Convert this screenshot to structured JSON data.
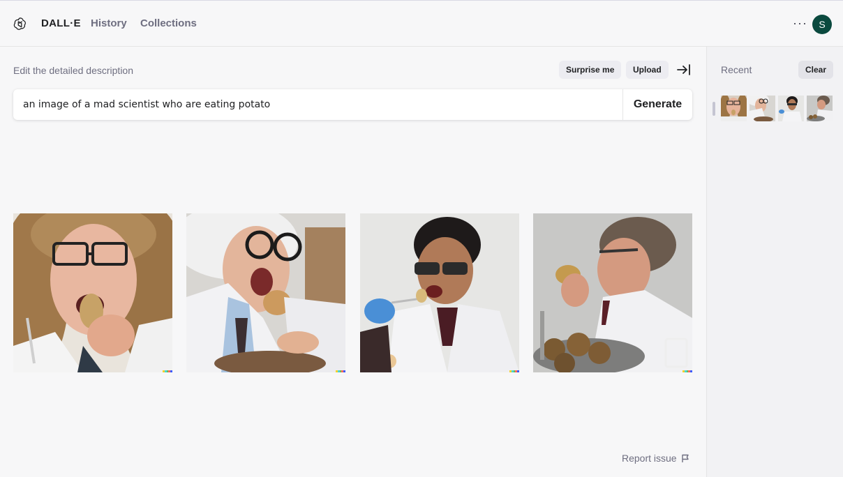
{
  "header": {
    "brand": "DALL·E",
    "nav": [
      {
        "label": "History"
      },
      {
        "label": "Collections"
      }
    ],
    "more_icon": "more-horizontal-icon",
    "avatar_initial": "S",
    "avatar_color": "#0b4a3f"
  },
  "editor": {
    "description_label": "Edit the detailed description",
    "surprise_label": "Surprise me",
    "upload_label": "Upload",
    "collapse_icon": "collapse-sidebar-icon",
    "prompt_value": "an image of a mad scientist who are eating potato",
    "generate_label": "Generate"
  },
  "results": {
    "images": [
      {
        "subject": "young scientist with long curly hair and glasses biting a potato"
      },
      {
        "subject": "wild-haired scientist in lab coat with glasses eating a potato"
      },
      {
        "subject": "scientist with glasses and blue glove eating from a fork"
      },
      {
        "subject": "grey-haired scientist biting a potato over a bowl of potatoes"
      }
    ]
  },
  "footer": {
    "report_label": "Report issue",
    "report_icon": "flag-icon"
  },
  "sidebar": {
    "recent_label": "Recent",
    "clear_label": "Clear",
    "recent_count": 4
  },
  "colors": {
    "background": "#f7f7f8",
    "sidebar_bg": "#f2f2f4",
    "pill_bg": "#ececf1",
    "muted_text": "#6e6e80"
  }
}
